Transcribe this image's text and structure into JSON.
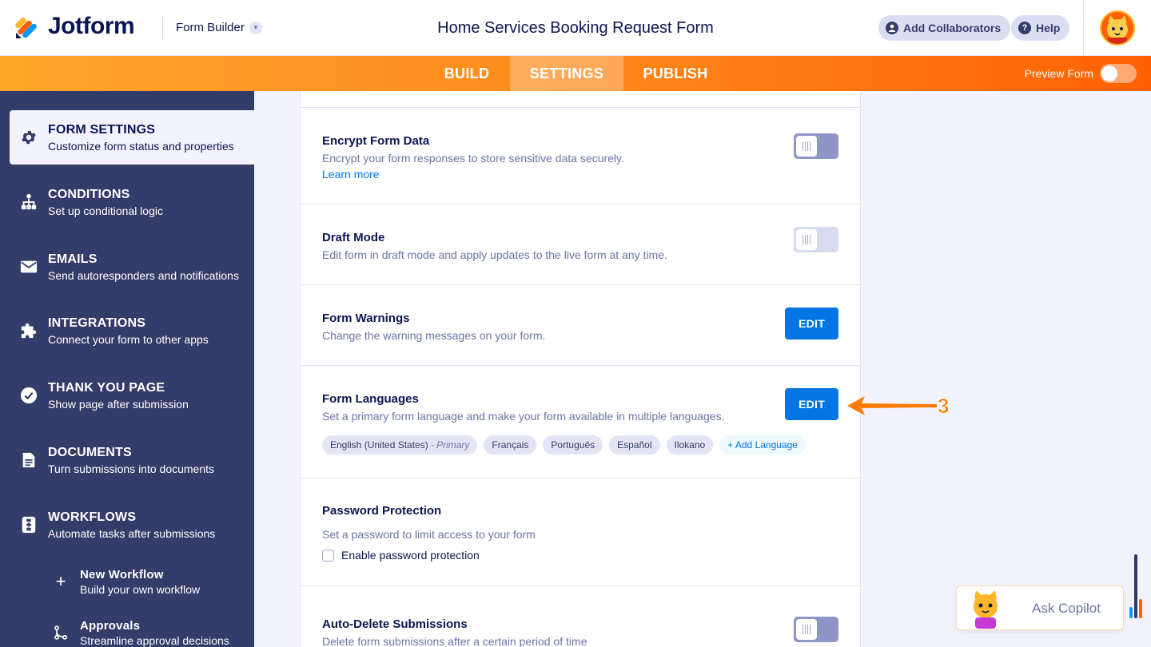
{
  "header": {
    "logo_text": "Jotform",
    "builder_label": "Form Builder",
    "form_title": "Home Services Booking Request Form",
    "add_collaborators_label": "Add Collaborators",
    "help_label": "Help"
  },
  "nav": {
    "tabs": [
      {
        "label": "BUILD",
        "active": false
      },
      {
        "label": "SETTINGS",
        "active": true
      },
      {
        "label": "PUBLISH",
        "active": false
      }
    ],
    "preview_label": "Preview Form",
    "preview_on": false
  },
  "sidebar": {
    "items": [
      {
        "title": "FORM SETTINGS",
        "sub": "Customize form status and properties",
        "icon": "gear-icon",
        "active": true
      },
      {
        "title": "CONDITIONS",
        "sub": "Set up conditional logic",
        "icon": "sitemap-icon",
        "active": false
      },
      {
        "title": "EMAILS",
        "sub": "Send autoresponders and notifications",
        "icon": "envelope-icon",
        "active": false
      },
      {
        "title": "INTEGRATIONS",
        "sub": "Connect your form to other apps",
        "icon": "puzzle-icon",
        "active": false
      },
      {
        "title": "THANK YOU PAGE",
        "sub": "Show page after submission",
        "icon": "check-circle-icon",
        "active": false
      },
      {
        "title": "DOCUMENTS",
        "sub": "Turn submissions into documents",
        "icon": "document-icon",
        "active": false
      },
      {
        "title": "WORKFLOWS",
        "sub": "Automate tasks after submissions",
        "icon": "workflow-icon",
        "active": false
      }
    ],
    "sub_items": [
      {
        "title": "New Workflow",
        "sub": "Build your own workflow",
        "icon": "plus-icon"
      },
      {
        "title": "Approvals",
        "sub": "Streamline approval decisions",
        "icon": "approval-flow-icon"
      }
    ]
  },
  "settings": {
    "encrypt": {
      "title": "Encrypt Form Data",
      "desc": "Encrypt your form responses to store sensitive data securely.",
      "link": "Learn more",
      "enabled": false
    },
    "draft": {
      "title": "Draft Mode",
      "desc": "Edit form in draft mode and apply updates to the live form at any time.",
      "enabled": false
    },
    "warnings": {
      "title": "Form Warnings",
      "desc": "Change the warning messages on your form.",
      "button": "EDIT"
    },
    "languages": {
      "title": "Form Languages",
      "desc": "Set a primary form language and make your form available in multiple languages.",
      "button": "EDIT",
      "primary": {
        "label": "English (United States)",
        "tag": "- Primary"
      },
      "others": [
        "Français",
        "Português",
        "Español",
        "Ilokano"
      ],
      "add_label": "+ Add Language"
    },
    "password": {
      "title": "Password Protection",
      "desc": "Set a password to limit access to your form",
      "checkbox_label": "Enable password protection",
      "checked": false
    },
    "autodelete": {
      "title": "Auto-Delete Submissions",
      "desc": "Delete form submissions after a certain period of time",
      "enabled": false
    }
  },
  "annotation": {
    "step": "3",
    "color": "#ff7a00"
  },
  "copilot": {
    "label": "Ask Copilot"
  },
  "colors": {
    "orange_start": "#ffa629",
    "orange_end": "#ff6100",
    "sidebar_bg": "#343c6a",
    "primary_blue": "#0075e3",
    "navy": "#0a1551"
  }
}
